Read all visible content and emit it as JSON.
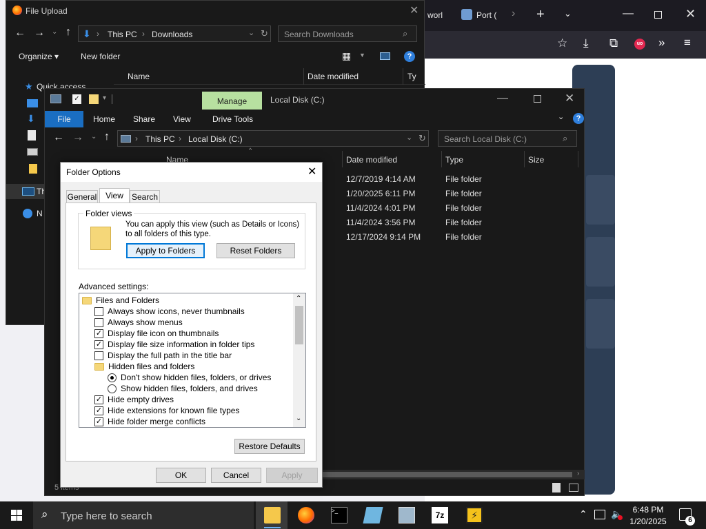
{
  "browser": {
    "tab1_label": "worl",
    "tab2_label": "Port (",
    "colors": {
      "chrome": "#1c1b22",
      "nav": "#2b2a33",
      "panel": "#2d3e55",
      "accent_red": "#e22850"
    }
  },
  "file_upload": {
    "title": "File Upload",
    "breadcrumb": [
      "This PC",
      "Downloads"
    ],
    "search_placeholder": "Search Downloads",
    "organize_label": "Organize",
    "new_folder_label": "New folder",
    "columns": {
      "name": "Name",
      "date": "Date modified",
      "type": "Ty"
    },
    "sidebar": [
      {
        "label": "Quick access",
        "icon": "star-icon"
      },
      {
        "label": "Th",
        "icon": "pc-icon"
      },
      {
        "label": "N",
        "icon": "network-icon"
      }
    ]
  },
  "explorer": {
    "title": "Local Disk (C:)",
    "manage_label": "Manage",
    "ribbon_tabs": [
      "File",
      "Home",
      "Share",
      "View",
      "Drive Tools"
    ],
    "breadcrumb": [
      "This PC",
      "Local Disk (C:)"
    ],
    "search_placeholder": "Search Local Disk (C:)",
    "columns": {
      "name": "Name",
      "date": "Date modified",
      "type": "Type",
      "size": "Size"
    },
    "rows": [
      {
        "date": "12/7/2019 4:14 AM",
        "type": "File folder"
      },
      {
        "date": "1/20/2025 6:11 PM",
        "type": "File folder"
      },
      {
        "date": "11/4/2024 4:01 PM",
        "type": "File folder"
      },
      {
        "date": "11/4/2024 3:56 PM",
        "type": "File folder"
      },
      {
        "date": "12/17/2024 9:14 PM",
        "type": "File folder"
      }
    ],
    "status": "5 items",
    "colors": {
      "file_tab": "#1a6ec2",
      "manage_tab": "#b7e0a0"
    }
  },
  "folder_options": {
    "title": "Folder Options",
    "tabs": [
      "General",
      "View",
      "Search"
    ],
    "active_tab": "View",
    "folder_views_label": "Folder views",
    "folder_views_text": "You can apply this view (such as Details or Icons) to all folders of this type.",
    "apply_to_folders_label": "Apply to Folders",
    "reset_folders_label": "Reset Folders",
    "advanced_label": "Advanced settings:",
    "tree": [
      {
        "label": "Files and Folders",
        "kind": "folder",
        "indent": 0
      },
      {
        "label": "Always show icons, never thumbnails",
        "kind": "check",
        "checked": false,
        "indent": 1
      },
      {
        "label": "Always show menus",
        "kind": "check",
        "checked": false,
        "indent": 1
      },
      {
        "label": "Display file icon on thumbnails",
        "kind": "check",
        "checked": true,
        "indent": 1
      },
      {
        "label": "Display file size information in folder tips",
        "kind": "check",
        "checked": true,
        "indent": 1
      },
      {
        "label": "Display the full path in the title bar",
        "kind": "check",
        "checked": false,
        "indent": 1
      },
      {
        "label": "Hidden files and folders",
        "kind": "folder",
        "indent": 1
      },
      {
        "label": "Don't show hidden files, folders, or drives",
        "kind": "radio",
        "checked": true,
        "indent": 2
      },
      {
        "label": "Show hidden files, folders, and drives",
        "kind": "radio",
        "checked": false,
        "indent": 2
      },
      {
        "label": "Hide empty drives",
        "kind": "check",
        "checked": true,
        "indent": 1
      },
      {
        "label": "Hide extensions for known file types",
        "kind": "check",
        "checked": true,
        "indent": 1
      },
      {
        "label": "Hide folder merge conflicts",
        "kind": "check",
        "checked": true,
        "indent": 1
      }
    ],
    "restore_defaults_label": "Restore Defaults",
    "ok_label": "OK",
    "cancel_label": "Cancel",
    "apply_label": "Apply"
  },
  "taskbar": {
    "search_placeholder": "Type here to search",
    "time": "6:48 PM",
    "date": "1/20/2025",
    "notification_count": "6"
  }
}
